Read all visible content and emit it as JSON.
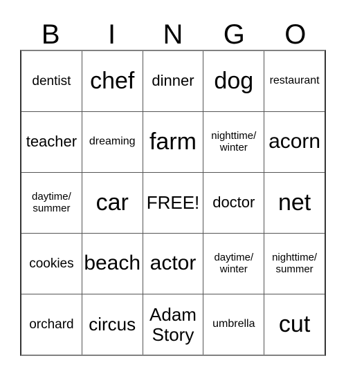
{
  "card": {
    "header_letters": [
      "B",
      "I",
      "N",
      "G",
      "O"
    ],
    "free_space_label": "FREE!",
    "rows": [
      [
        {
          "text": "dentist",
          "size": "fs-md"
        },
        {
          "text": "chef",
          "size": "fs-3xl"
        },
        {
          "text": "dinner",
          "size": "fs-lg"
        },
        {
          "text": "dog",
          "size": "fs-3xl"
        },
        {
          "text": "restaurant",
          "size": "fs-sm"
        }
      ],
      [
        {
          "text": "teacher",
          "size": "fs-lg"
        },
        {
          "text": "dreaming",
          "size": "fs-sm"
        },
        {
          "text": "farm",
          "size": "fs-3xl"
        },
        {
          "text": "nighttime/\nwinter",
          "size": "fs-two-line-sm"
        },
        {
          "text": "acorn",
          "size": "fs-2xl"
        }
      ],
      [
        {
          "text": "daytime/\nsummer",
          "size": "fs-two-line-sm"
        },
        {
          "text": "car",
          "size": "fs-3xl"
        },
        {
          "text": "FREE!",
          "size": "fs-xl"
        },
        {
          "text": "doctor",
          "size": "fs-lg"
        },
        {
          "text": "net",
          "size": "fs-3xl"
        }
      ],
      [
        {
          "text": "cookies",
          "size": "fs-md"
        },
        {
          "text": "beach",
          "size": "fs-2xl"
        },
        {
          "text": "actor",
          "size": "fs-2xl"
        },
        {
          "text": "daytime/\nwinter",
          "size": "fs-two-line-sm"
        },
        {
          "text": "nighttime/\nsummer",
          "size": "fs-two-line-sm"
        }
      ],
      [
        {
          "text": "orchard",
          "size": "fs-md"
        },
        {
          "text": "circus",
          "size": "fs-xl"
        },
        {
          "text": "Adam\nStory",
          "size": "fs-two-line-lg"
        },
        {
          "text": "umbrella",
          "size": "fs-sm"
        },
        {
          "text": "cut",
          "size": "fs-3xl"
        }
      ]
    ]
  },
  "colors": {
    "background": "#ffffff",
    "text": "#000000",
    "grid_line": "#555555",
    "grid_outer_line": "#333333"
  }
}
